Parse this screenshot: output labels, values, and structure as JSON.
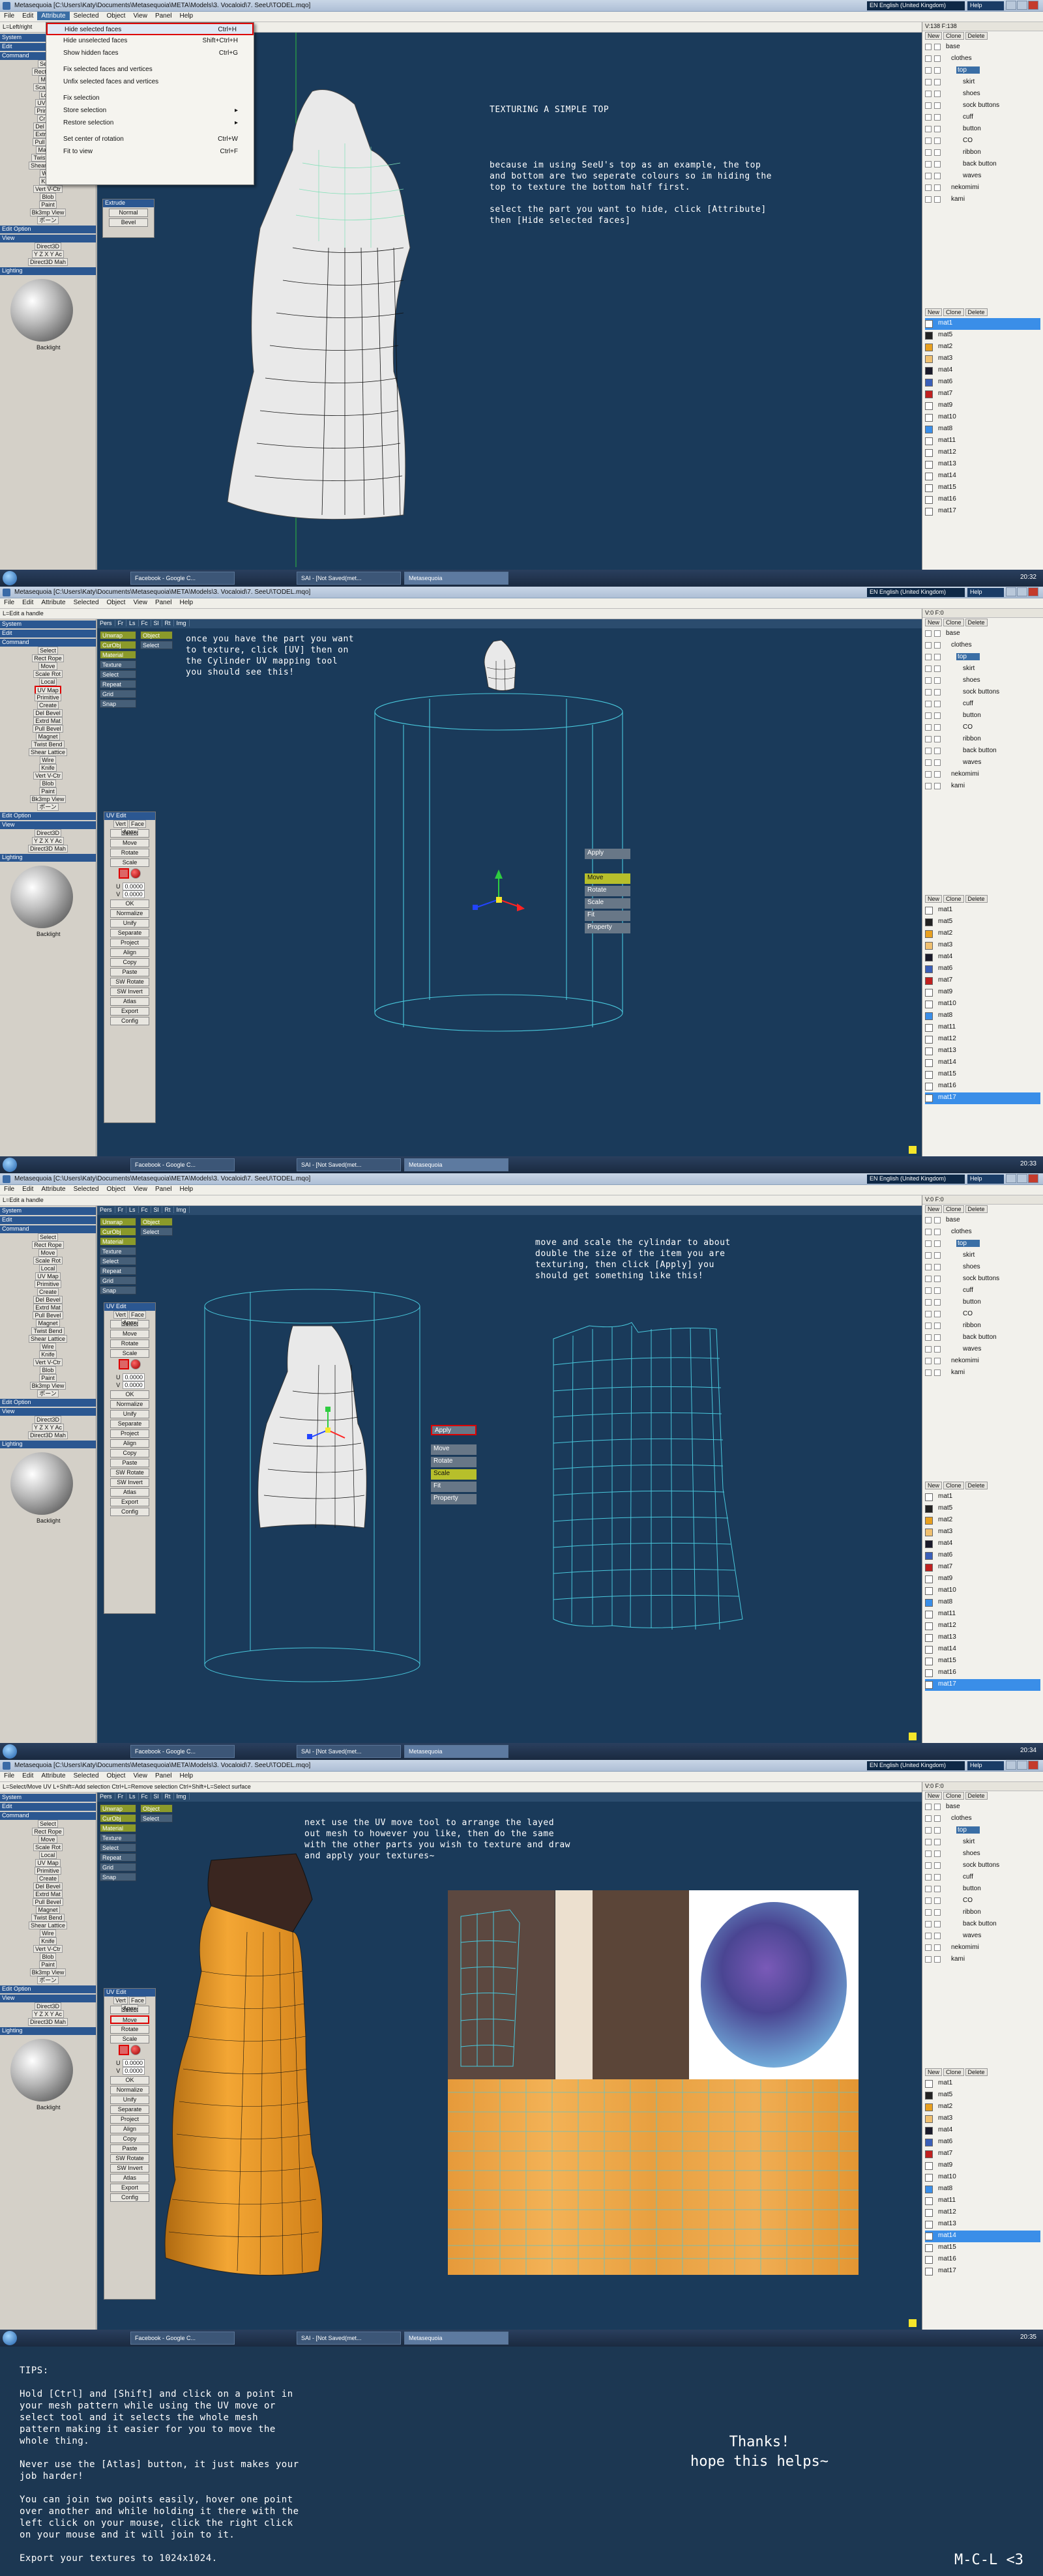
{
  "window": {
    "title": "Metasequoia [C:\\Users\\Katy\\Documents\\Metasequoia\\META\\Models\\3. Vocaloid\\7. SeeU\\TODEL.mqo]",
    "language": "EN English (United Kingdom)",
    "help": "Help"
  },
  "menu": [
    "File",
    "Edit",
    "Attribute",
    "Selected",
    "Object",
    "View",
    "Panel",
    "Help"
  ],
  "hints": {
    "s1": "L=Left/right",
    "s2": "L=Edit a handle",
    "s3": "L=Edit a handle",
    "s4": "L=Select/Move UV  L+Shift=Add selection  Ctrl+L=Remove selection  Ctrl+Shift+L=Select surface"
  },
  "attribute_menu": [
    {
      "label": "Hide selected faces",
      "shortcut": "Ctrl+H",
      "highlight": true
    },
    {
      "label": "Hide unselected faces",
      "shortcut": "Shift+Ctrl+H"
    },
    {
      "label": "Show hidden faces",
      "shortcut": "Ctrl+G"
    },
    {
      "sep": true
    },
    {
      "label": "Fix selected faces and vertices",
      "shortcut": ""
    },
    {
      "label": "Unfix selected faces and vertices",
      "shortcut": ""
    },
    {
      "sep": true
    },
    {
      "label": "Fix selection",
      "shortcut": ""
    },
    {
      "label": "Store selection",
      "shortcut": "▸"
    },
    {
      "label": "Restore selection",
      "shortcut": "▸"
    },
    {
      "sep": true
    },
    {
      "label": "Set center of rotation",
      "shortcut": "Ctrl+W"
    },
    {
      "label": "Fit to view",
      "shortcut": "Ctrl+F"
    }
  ],
  "left_panel": {
    "system": "System",
    "edit": "Edit",
    "command": "Command",
    "rows": [
      "Select",
      "Rect  Rope",
      "Move",
      "Scale  Rot",
      "Local",
      "UV  Map",
      "Primitive",
      "Create",
      "Del  Bevel",
      "Extrd  Mat",
      "Pull  Bevel",
      "Magnet",
      "Twist  Bend",
      "Shear  Lattice",
      "Wire",
      "Knife",
      "Vert  V-Ctr",
      "Blob",
      "Paint",
      "Bk3mp  View",
      "ポーン"
    ],
    "edit_option": "Edit Option",
    "view": "View",
    "view_rows": [
      "Direct3D",
      "Y Z  X Y  Ac",
      "Direct3D  Mah"
    ],
    "lighting": "Lighting",
    "backlight": "Backlight"
  },
  "extrude_box": {
    "title": "Extrude",
    "buttons": [
      "Normal",
      "Bevel"
    ]
  },
  "uv_box": {
    "title": "UV Edit",
    "mode": [
      "Vert",
      "Face",
      "Apex"
    ],
    "buttons_top": [
      "Select",
      "Move",
      "Rotate",
      "Scale"
    ],
    "u_label": "U",
    "u_value": "0.0000",
    "v_label": "V",
    "v_value": "0.0000",
    "ok": "OK",
    "buttons_bottom": [
      "Normalize",
      "Unify",
      "Separate",
      "Project",
      "Align",
      "Copy",
      "Paste",
      "SW Rotate",
      "SW Invert",
      "Atlas",
      "Export",
      "Config"
    ]
  },
  "viewport_tabs": [
    "Pers",
    "Fr",
    "Ls",
    "Fc",
    "Sl",
    "Rt",
    "Img"
  ],
  "viewport_tools": {
    "left": [
      "Unwrap",
      "CurObj",
      "Material",
      "Texture",
      "Select",
      "Repeat",
      "Grid",
      "Snap"
    ],
    "right": [
      "Object",
      "Select"
    ]
  },
  "handle_menu": [
    "Apply",
    "Move",
    "Rotate",
    "Scale",
    "Fit",
    "Property"
  ],
  "instructions": {
    "s1": "TEXTURING A SIMPLE TOP\n\n\n\n\nbecause im using SeeU's top as an example, the top\nand bottom are two seperate colours so im hiding the\ntop to texture the bottom half first.\n\nselect the part you want to hide, click [Attribute]\nthen [Hide selected faces]",
    "s2": "once you have the part you want\nto texture, click [UV] then on\nthe Cylinder UV mapping tool\nyou should see this!",
    "s3": "move and scale the cylindar to about\ndouble the size of the item you are\ntexturing, then click [Apply] you\nshould get something like this!",
    "s4": "next use the UV move tool to arrange the layed\nout mesh to however you like, then do the same\nwith the other parts you wish to texture and draw\nand apply your textures~"
  },
  "right_panel": {
    "top1": "V:138   F:138",
    "top2": "V:0   F:0",
    "buttons": [
      "New",
      "Clone",
      "Delete"
    ],
    "props": [
      "Prop",
      "Misc"
    ],
    "objects": [
      "base",
      "clothes",
      "top",
      "skirt",
      "shoes",
      "sock buttons",
      "cuff",
      "button",
      "CO",
      "ribbon",
      "back button",
      "waves",
      "nekomimi",
      "kami"
    ],
    "materials": [
      "mat1",
      "mat5",
      "mat2",
      "mat3",
      "mat4",
      "mat6",
      "mat7",
      "mat9",
      "mat10",
      "mat8",
      "mat11",
      "mat12",
      "mat13",
      "mat14",
      "mat15",
      "mat16",
      "mat17"
    ],
    "material_colors": [
      "#ffffff",
      "#222222",
      "#e8a020",
      "#f0c070",
      "#1a1a2a",
      "#3a5fb8",
      "#c02020",
      "#ffffff",
      "#ffffff",
      "#3a8ee8",
      "#ffffff",
      "#ffffff",
      "#ffffff",
      "#ffffff",
      "#ffffff",
      "#ffffff",
      "#ffffff"
    ]
  },
  "taskbar": {
    "items": [
      "Facebook - Google C...",
      "SAI - [Not Saved(met...",
      "Metasequoia"
    ],
    "clocks": [
      "20:32",
      "20:33",
      "20:34",
      "20:35"
    ]
  },
  "tips": {
    "text": "TIPS:\n\nHold [Ctrl] and [Shift] and click on a point in\nyour mesh pattern while using the UV move or\nselect tool and it selects the whole mesh\npattern making it easier for you to move the\nwhole thing.\n\nNever use the [Atlas] button, it just makes your\njob harder!\n\nYou can join two points easily, hover one point\nover another and while holding it there with the\nleft click on your mouse, click the right click\non your mouse and it will join to it.\n\nExport your textures to 1024x1024.",
    "thanks": "Thanks!\nhope this helps~",
    "signature": "M-C-L <3"
  },
  "colors": {
    "bg": "#1c3752",
    "viewport": "#1a3a5a",
    "accent": "#3a6ea5",
    "highlight": "#d00000",
    "uv_wire": "#49c8dc"
  }
}
